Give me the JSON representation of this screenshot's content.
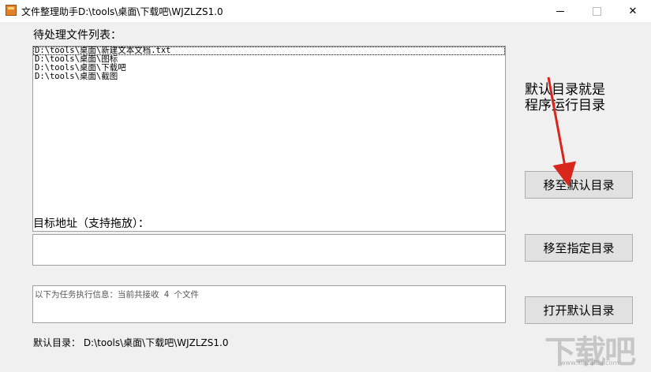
{
  "window": {
    "title": "文件整理助手D:\\tools\\桌面\\下载吧\\WJZLZS1.0",
    "minimize_glyph": "",
    "close_glyph": "✕"
  },
  "pending": {
    "label": "待处理文件列表：",
    "items": [
      "D:\\tools\\桌面\\新建文本文档.txt",
      "D:\\tools\\桌面\\图标",
      "D:\\tools\\桌面\\下载吧",
      "D:\\tools\\桌面\\截图"
    ]
  },
  "note": {
    "line1": "默认目录就是",
    "line2": "程序运行目录"
  },
  "buttons": {
    "move_default": "移至默认目录",
    "move_specified": "移至指定目录",
    "open_default": "打开默认目录"
  },
  "target": {
    "label": "目标地址（支持拖放）：",
    "value": ""
  },
  "info": {
    "text": "以下为任务执行信息：当前共接收 4 个文件"
  },
  "footer": {
    "default_dir": "默认目录： D:\\tools\\桌面\\下载吧\\WJZLZS1.0"
  },
  "watermark": {
    "text": "下载吧",
    "sub": "www.xiazaiba.com"
  },
  "colors": {
    "annotation_arrow": "#d9261c",
    "client_bg": "#f0f0f0",
    "button_bg": "#e1e1e1"
  }
}
